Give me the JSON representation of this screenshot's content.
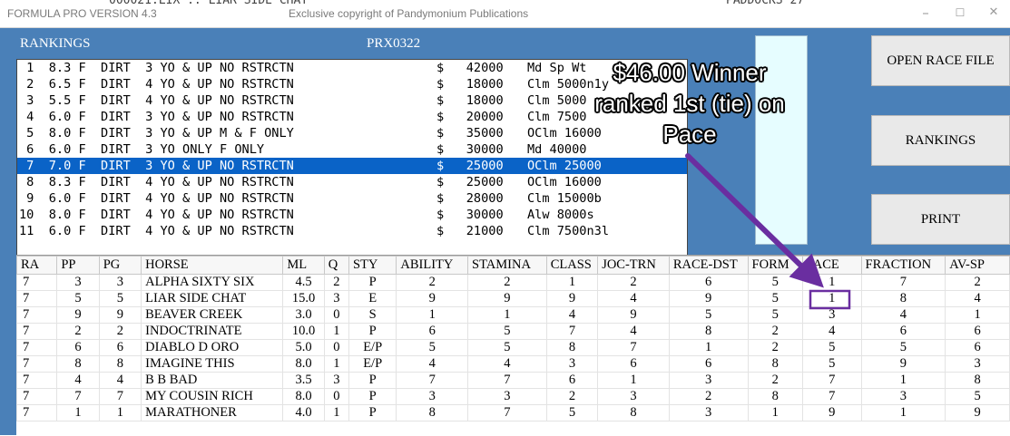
{
  "window": {
    "app_title": "FORMULA PRO VERSION 4.3",
    "copyright": "Exclusive copyright of Pandymonium Publications",
    "controls": {
      "minimize": "–",
      "maximize": "☐",
      "close": "✕"
    },
    "background_fragments": {
      "left": "000021:LIX  ..  LIAR SIDE CHAT",
      "right": "PADDOCKS  27"
    }
  },
  "panel": {
    "rankings_label": "RANKINGS",
    "file_code": "PRX0322"
  },
  "races": [
    {
      "text": " 1  8.3 F  DIRT  3 YO & UP NO RSTRCTN",
      "purse": "$   42000",
      "type": "Md Sp Wt"
    },
    {
      "text": " 2  6.5 F  DIRT  4 YO & UP NO RSTRCTN",
      "purse": "$   18000",
      "type": "Clm 5000n1y"
    },
    {
      "text": " 3  5.5 F  DIRT  4 YO & UP NO RSTRCTN",
      "purse": "$   18000",
      "type": "Clm 5000"
    },
    {
      "text": " 4  6.0 F  DIRT  3 YO & UP NO RSTRCTN",
      "purse": "$   20000",
      "type": "Clm 7500"
    },
    {
      "text": " 5  8.0 F  DIRT  3 YO & UP M & F ONLY",
      "purse": "$   35000",
      "type": "OClm 16000"
    },
    {
      "text": " 6  6.0 F  DIRT  3 YO ONLY F ONLY",
      "purse": "$   30000",
      "type": "Md 40000"
    },
    {
      "text": " 7  7.0 F  DIRT  3 YO & UP NO RSTRCTN",
      "purse": "$   25000",
      "type": "OClm 25000"
    },
    {
      "text": " 8  8.3 F  DIRT  4 YO & UP NO RSTRCTN",
      "purse": "$   25000",
      "type": "OClm 16000"
    },
    {
      "text": " 9  6.0 F  DIRT  4 YO & UP NO RSTRCTN",
      "purse": "$   28000",
      "type": "Clm 15000b"
    },
    {
      "text": "10  8.0 F  DIRT  4 YO & UP NO RSTRCTN",
      "purse": "$   30000",
      "type": "Alw 8000s"
    },
    {
      "text": "11  6.0 F  DIRT  4 YO & UP NO RSTRCTN",
      "purse": "$   21000",
      "type": "Clm 7500n3l"
    }
  ],
  "selected_race_index": 6,
  "buttons": {
    "open_race_file": "OPEN RACE FILE",
    "rankings": "RANKINGS",
    "print": "PRINT"
  },
  "grid": {
    "columns": [
      "RA",
      "PP",
      "PG",
      "HORSE",
      "ML",
      "Q",
      "STY",
      "ABILITY",
      "STAMINA",
      "CLASS",
      "JOC-TRN",
      "RACE-DST",
      "FORM",
      "PACE",
      "FRACTION",
      "AV-SP"
    ],
    "rows": [
      [
        "7",
        "3",
        "3",
        "ALPHA SIXTY SIX",
        "4.5",
        "2",
        "P",
        "2",
        "2",
        "1",
        "2",
        "6",
        "5",
        "1",
        "7",
        "2"
      ],
      [
        "7",
        "5",
        "5",
        "LIAR SIDE CHAT",
        "15.0",
        "3",
        "E",
        "9",
        "9",
        "9",
        "4",
        "9",
        "5",
        "1",
        "8",
        "4"
      ],
      [
        "7",
        "9",
        "9",
        "BEAVER CREEK",
        "3.0",
        "0",
        "S",
        "1",
        "1",
        "4",
        "9",
        "5",
        "5",
        "3",
        "4",
        "1"
      ],
      [
        "7",
        "2",
        "2",
        "INDOCTRINATE",
        "10.0",
        "1",
        "P",
        "6",
        "5",
        "7",
        "4",
        "8",
        "2",
        "4",
        "6",
        "6"
      ],
      [
        "7",
        "6",
        "6",
        "DIABLO D ORO",
        "5.0",
        "0",
        "E/P",
        "5",
        "5",
        "8",
        "7",
        "1",
        "2",
        "5",
        "5",
        "6"
      ],
      [
        "7",
        "8",
        "8",
        "IMAGINE THIS",
        "8.0",
        "1",
        "E/P",
        "4",
        "4",
        "3",
        "6",
        "6",
        "8",
        "5",
        "9",
        "3"
      ],
      [
        "7",
        "4",
        "4",
        "B B BAD",
        "3.5",
        "3",
        "P",
        "7",
        "7",
        "6",
        "1",
        "3",
        "2",
        "7",
        "1",
        "8"
      ],
      [
        "7",
        "7",
        "7",
        "MY COUSIN RICH",
        "8.0",
        "0",
        "P",
        "3",
        "3",
        "2",
        "3",
        "2",
        "8",
        "7",
        "3",
        "5"
      ],
      [
        "7",
        "1",
        "1",
        "MARATHONER",
        "4.0",
        "1",
        "P",
        "8",
        "7",
        "5",
        "8",
        "3",
        "1",
        "9",
        "1",
        "9"
      ]
    ]
  },
  "annotation": {
    "line1": "$46.00 Winner",
    "line2": "ranked 1st (tie) on",
    "line3": "Pace",
    "color": "#6a2ea0",
    "highlight": {
      "row": 1,
      "column": "PACE"
    }
  },
  "colors": {
    "panel_blue": "#4a80b8",
    "selection_blue": "#0a63c7",
    "side_box": "#e6fdff",
    "annotation_purple": "#6a2ea0"
  }
}
